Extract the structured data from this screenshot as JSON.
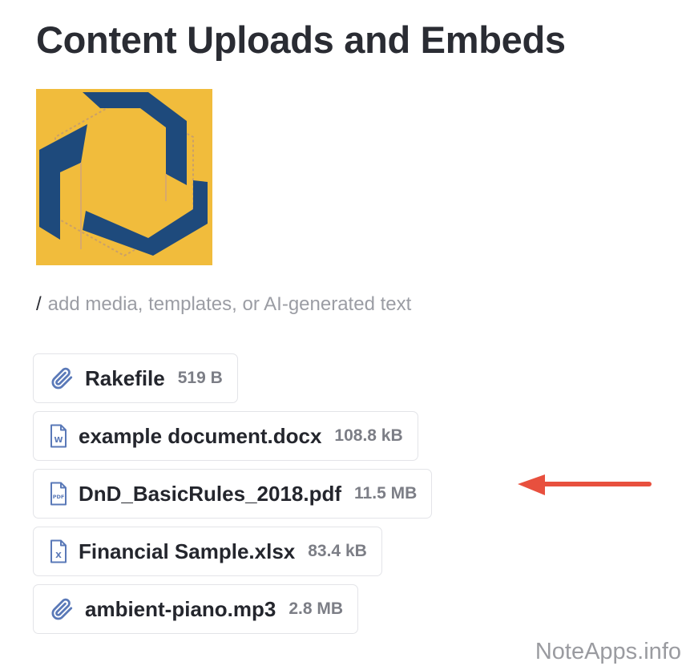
{
  "page": {
    "title": "Content Uploads and Embeds",
    "command_prefix": "/",
    "command_placeholder": "add media, templates, or AI-generated text"
  },
  "hero_image": {
    "icon": "hexagon-logo-image",
    "colors": {
      "background": "#f1bc3c",
      "shape": "#1e4a7c"
    }
  },
  "attachments": [
    {
      "name": "Rakefile",
      "size": "519 B",
      "icon": "paperclip-icon"
    },
    {
      "name": "example document.docx",
      "size": "108.8 kB",
      "icon": "word-file-icon"
    },
    {
      "name": "DnD_BasicRules_2018.pdf",
      "size": "11.5 MB",
      "icon": "pdf-file-icon"
    },
    {
      "name": "Financial Sample.xlsx",
      "size": "83.4 kB",
      "icon": "excel-file-icon"
    },
    {
      "name": "ambient-piano.mp3",
      "size": "2.8 MB",
      "icon": "paperclip-icon"
    }
  ],
  "annotation": {
    "color": "#e8503e",
    "points_to": "DnD_BasicRules_2018.pdf"
  },
  "watermark": "NoteApps.info",
  "colors": {
    "icon_blue": "#5a79b8",
    "border": "#e3e4e8"
  }
}
